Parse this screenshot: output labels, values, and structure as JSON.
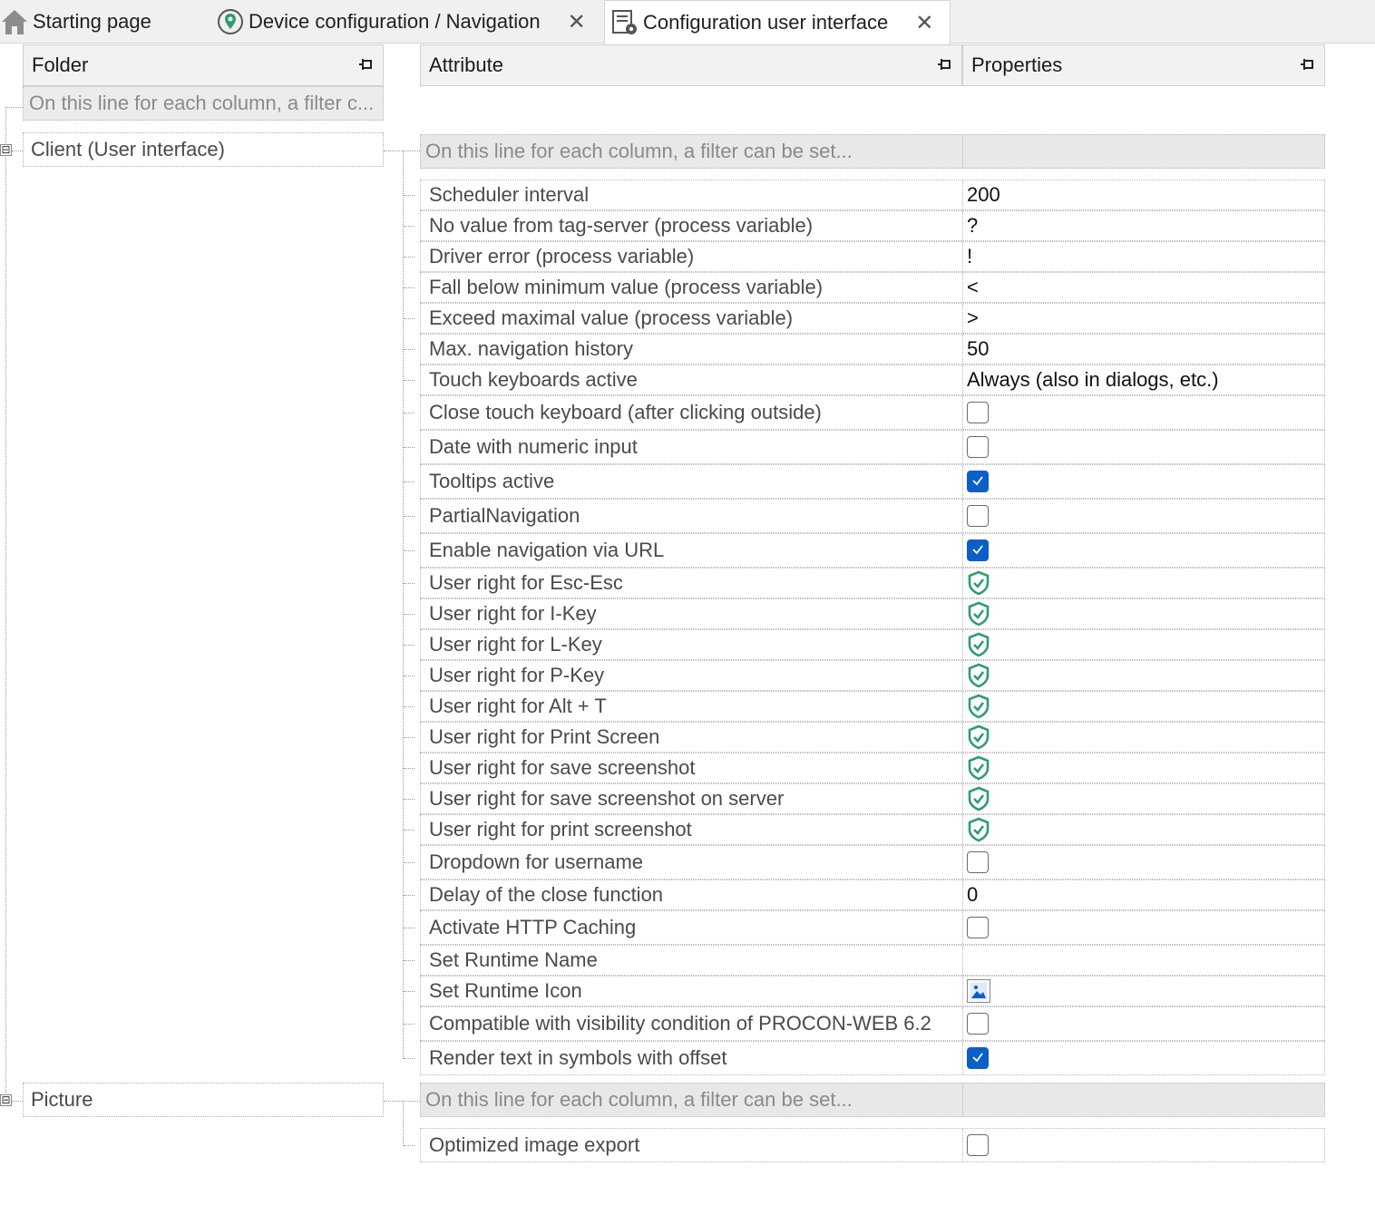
{
  "tabs": [
    {
      "label": "Starting page",
      "icon": "home-icon"
    },
    {
      "label": "Device configuration / Navigation",
      "icon": "location-pin-icon",
      "close": "✕"
    },
    {
      "label": "Configuration user interface",
      "icon": "config-ui-icon",
      "close": "✕",
      "active": true
    }
  ],
  "folder_panel": {
    "header": "Folder",
    "filter_placeholder": "On this line for each column, a filter c...",
    "nodes": [
      {
        "label": "Client (User interface)",
        "expander": "⊟"
      },
      {
        "label": "Picture",
        "expander": "⊟"
      }
    ]
  },
  "grid": {
    "attribute_header": "Attribute",
    "properties_header": "Properties",
    "filter_placeholder": "On this line for each column, a filter can be set...",
    "client_rows": [
      {
        "attr": "Scheduler interval",
        "type": "text",
        "value": "200"
      },
      {
        "attr": "No value from tag-server (process variable)",
        "type": "text",
        "value": "?"
      },
      {
        "attr": "Driver error (process variable)",
        "type": "text",
        "value": "!"
      },
      {
        "attr": "Fall below minimum value (process variable)",
        "type": "text",
        "value": "<"
      },
      {
        "attr": "Exceed maximal value (process variable)",
        "type": "text",
        "value": ">"
      },
      {
        "attr": "Max. navigation history",
        "type": "text",
        "value": "50"
      },
      {
        "attr": "Touch keyboards active",
        "type": "text",
        "value": "Always (also in dialogs, etc.)"
      },
      {
        "attr": "Close touch keyboard (after clicking outside)",
        "type": "checkbox",
        "checked": false
      },
      {
        "attr": "Date with numeric input",
        "type": "checkbox",
        "checked": false
      },
      {
        "attr": "Tooltips active",
        "type": "checkbox",
        "checked": true
      },
      {
        "attr": "PartialNavigation",
        "type": "checkbox",
        "checked": false
      },
      {
        "attr": "Enable navigation via URL",
        "type": "checkbox",
        "checked": true
      },
      {
        "attr": "User right for Esc-Esc",
        "type": "shield"
      },
      {
        "attr": "User right for I-Key",
        "type": "shield"
      },
      {
        "attr": "User right for L-Key",
        "type": "shield"
      },
      {
        "attr": "User right for P-Key",
        "type": "shield"
      },
      {
        "attr": "User right for Alt + T",
        "type": "shield"
      },
      {
        "attr": "User right for Print Screen",
        "type": "shield"
      },
      {
        "attr": "User right for save screenshot",
        "type": "shield"
      },
      {
        "attr": "User right for save screenshot on server",
        "type": "shield"
      },
      {
        "attr": "User right for print screenshot",
        "type": "shield"
      },
      {
        "attr": "Dropdown for username",
        "type": "checkbox",
        "checked": false
      },
      {
        "attr": "Delay of the close function",
        "type": "text",
        "value": "0"
      },
      {
        "attr": "Activate HTTP Caching",
        "type": "checkbox",
        "checked": false
      },
      {
        "attr": "Set Runtime Name",
        "type": "text",
        "value": ""
      },
      {
        "attr": "Set Runtime Icon",
        "type": "image"
      },
      {
        "attr": "Compatible with visibility condition of PROCON-WEB 6.2",
        "type": "checkbox",
        "checked": false
      },
      {
        "attr": "Render text in symbols with offset",
        "type": "checkbox",
        "checked": true
      }
    ],
    "picture_rows": [
      {
        "attr": "Optimized image export",
        "type": "checkbox",
        "checked": false
      }
    ]
  },
  "colors": {
    "accent": "#0b5fc9",
    "shield": "#2e9d6e",
    "header_bg": "#f2f2f2"
  }
}
